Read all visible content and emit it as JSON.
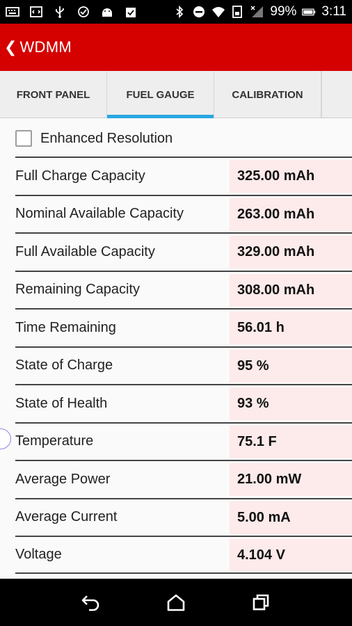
{
  "status_bar": {
    "battery_percent": "99%",
    "time": "3:11",
    "icons": [
      "keyboard-icon",
      "developer-icon",
      "usb-icon",
      "sync-icon",
      "android-icon",
      "clipboard-icon",
      "bluetooth-icon",
      "do-not-disturb-icon",
      "wifi-icon",
      "sim-icon",
      "signal-icon",
      "battery-icon"
    ]
  },
  "app_bar": {
    "back_glyph": "❮",
    "title": "WDMM"
  },
  "tabs": [
    {
      "label": "FRONT PANEL",
      "active": false
    },
    {
      "label": "FUEL GAUGE",
      "active": true
    },
    {
      "label": "CALIBRATION",
      "active": false
    }
  ],
  "options": {
    "enhanced_resolution_label": "Enhanced Resolution",
    "enhanced_resolution_checked": false
  },
  "readings": [
    {
      "label": "Full Charge Capacity",
      "value": "325.00 mAh"
    },
    {
      "label": "Nominal Available Capacity",
      "value": "263.00 mAh"
    },
    {
      "label": "Full Available Capacity",
      "value": "329.00 mAh"
    },
    {
      "label": "Remaining Capacity",
      "value": "308.00 mAh"
    },
    {
      "label": "Time Remaining",
      "value": "56.01 h"
    },
    {
      "label": "State of Charge",
      "value": "95 %"
    },
    {
      "label": "State of Health",
      "value": "93 %"
    },
    {
      "label": "Temperature",
      "value": "75.1 F"
    },
    {
      "label": "Average Power",
      "value": "21.00 mW"
    },
    {
      "label": "Average Current",
      "value": "5.00 mA"
    },
    {
      "label": "Voltage",
      "value": "4.104 V"
    }
  ],
  "colors": {
    "app_bar": "#d50000",
    "tab_indicator": "#29a8e0",
    "value_cell": "#fdeaea"
  }
}
